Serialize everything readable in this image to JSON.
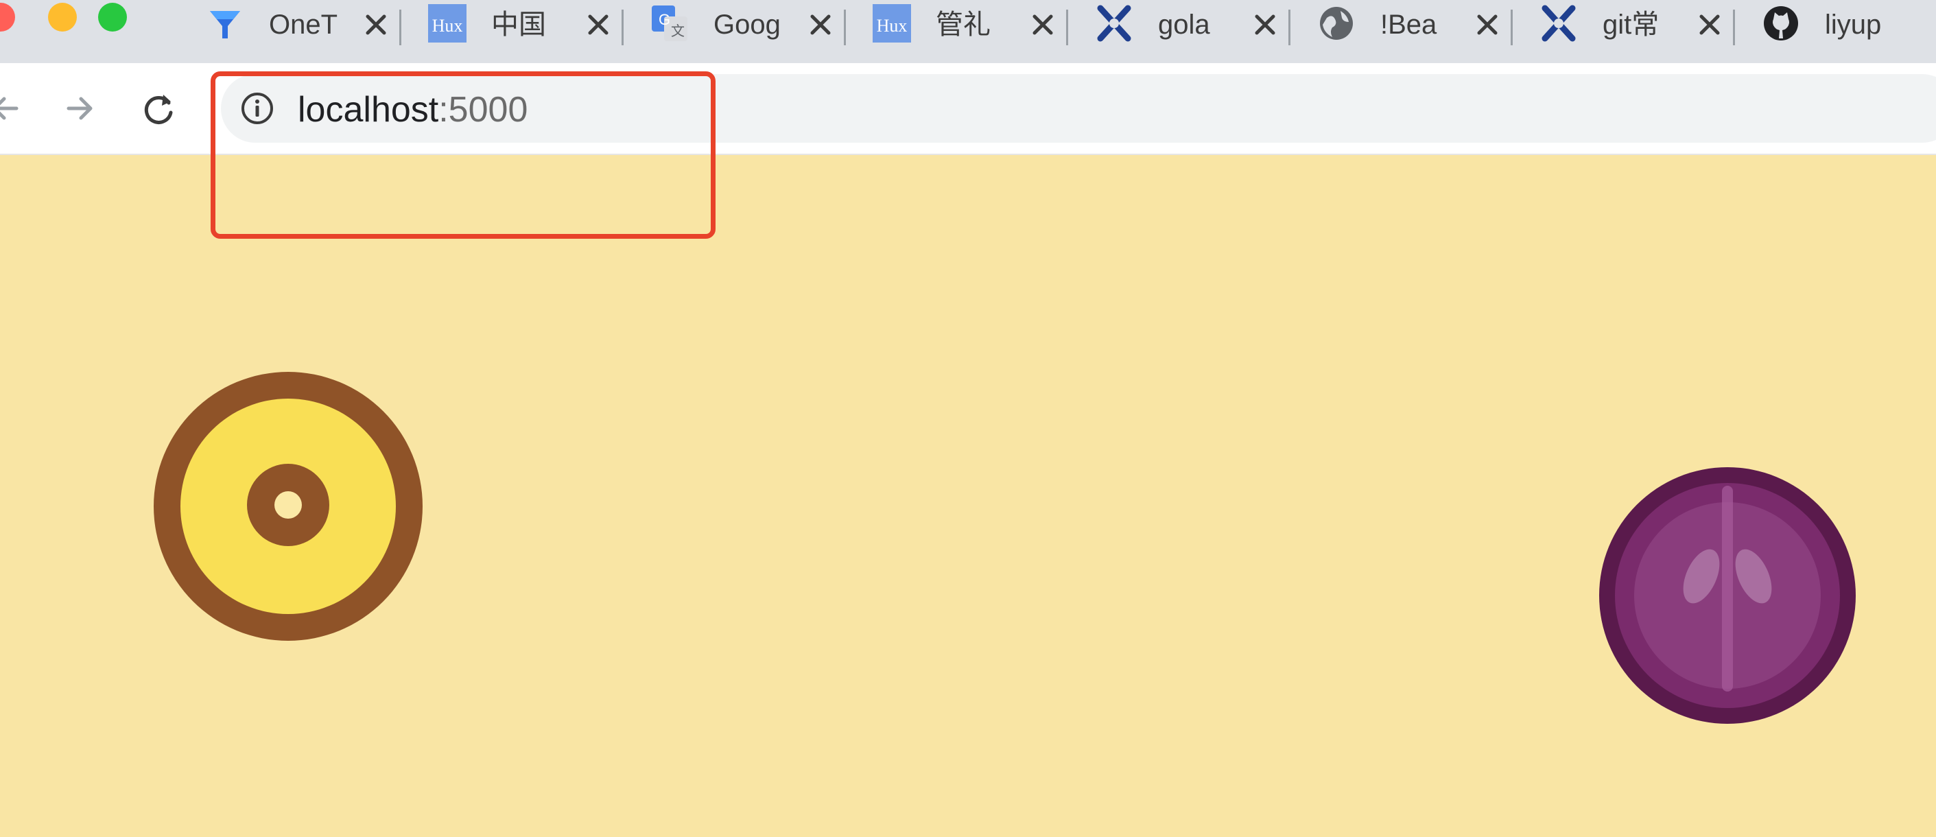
{
  "window": {
    "traffic_lights": {
      "close": "#ff5f57",
      "minimize": "#febc2e",
      "zoom": "#28c840"
    }
  },
  "tabs": [
    {
      "title": "OneT",
      "icon": "funnel-icon"
    },
    {
      "title": "中国",
      "icon": "hux-icon"
    },
    {
      "title": "Goog",
      "icon": "google-translate-icon"
    },
    {
      "title": "管礼",
      "icon": "hux-icon"
    },
    {
      "title": "gola",
      "icon": "logo-x-icon"
    },
    {
      "title": "!Bea",
      "icon": "globe-icon"
    },
    {
      "title": "git常",
      "icon": "logo-x-icon"
    },
    {
      "title": "liyup",
      "icon": "github-icon"
    }
  ],
  "toolbar": {
    "url_host": "localhost",
    "url_port": ":5000",
    "info_icon": "info-icon",
    "back_icon": "back-arrow-icon",
    "forward_icon": "forward-arrow-icon",
    "reload_icon": "reload-icon"
  },
  "page": {
    "background": "#f9e5a4",
    "highlight_color": "#e8422a",
    "sprites": [
      {
        "name": "yellow-ring-sprite",
        "colors": {
          "outer": "#8f5328",
          "inner": "#f9df55"
        }
      },
      {
        "name": "purple-ball-sprite",
        "colors": {
          "outer": "#5a1a4c",
          "inner": "#8a3d7d"
        }
      }
    ]
  }
}
